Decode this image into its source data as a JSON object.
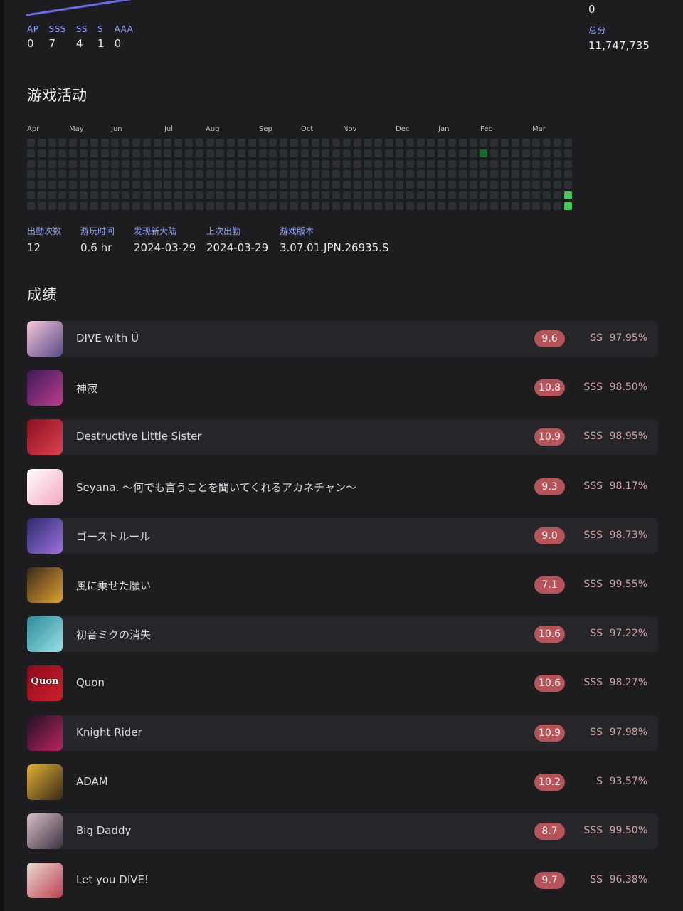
{
  "top_stats": [
    {
      "label": "AP",
      "value": "0"
    },
    {
      "label": "SSS",
      "value": "7"
    },
    {
      "label": "SS",
      "value": "4"
    },
    {
      "label": "S",
      "value": "1"
    },
    {
      "label": "AAA",
      "value": "0"
    }
  ],
  "top_right_value": "0",
  "total": {
    "label": "总分",
    "value": "11,747,735"
  },
  "activity": {
    "title": "游戏活动",
    "months": [
      "Apr",
      "May",
      "Jun",
      "Jul",
      "Aug",
      "Sep",
      "Oct",
      "Nov",
      "Dec",
      "Jan",
      "Feb",
      "Mar"
    ],
    "weeks": 52,
    "active_cells": [
      {
        "week": 43,
        "day": 1,
        "level": 1
      },
      {
        "week": 51,
        "day": 5,
        "level": 3
      },
      {
        "week": 51,
        "day": 6,
        "level": 3
      }
    ],
    "colors": {
      "empty": "#2b2f36",
      "low": "#166a2a",
      "high": "#3fcd51"
    }
  },
  "meta": [
    {
      "label": "出勤次数",
      "value": "12"
    },
    {
      "label": "游玩时间",
      "value": "0.6 hr"
    },
    {
      "label": "发现新大陆",
      "value": "2024-03-29"
    },
    {
      "label": "上次出勤",
      "value": "2024-03-29"
    },
    {
      "label": "游戏版本",
      "value": "3.07.01.JPN.26935.S"
    }
  ],
  "scores": {
    "title": "成绩",
    "rows": [
      {
        "title": "DIVE with Ü",
        "level": "9.6",
        "rank": "SS",
        "accuracy": "97.95%",
        "cover_colors": [
          "#f4c8d8",
          "#5a4a8a"
        ],
        "cover_text": ""
      },
      {
        "title": "神寂",
        "level": "10.8",
        "rank": "SSS",
        "accuracy": "98.50%",
        "cover_colors": [
          "#3a1d5a",
          "#c03a8a"
        ],
        "cover_text": ""
      },
      {
        "title": "Destructive Little Sister",
        "level": "10.9",
        "rank": "SSS",
        "accuracy": "98.95%",
        "cover_colors": [
          "#8a1020",
          "#e04050"
        ],
        "cover_text": ""
      },
      {
        "title": "Seyana. ～何でも言うことを聞いてくれるアカネチャン～",
        "level": "9.3",
        "rank": "SSS",
        "accuracy": "98.17%",
        "cover_colors": [
          "#ffffff",
          "#f4a6c0"
        ],
        "cover_text": ""
      },
      {
        "title": "ゴーストルール",
        "level": "9.0",
        "rank": "SSS",
        "accuracy": "98.73%",
        "cover_colors": [
          "#2a2a6a",
          "#a070e0"
        ],
        "cover_text": ""
      },
      {
        "title": "風に乗せた願い",
        "level": "7.1",
        "rank": "SSS",
        "accuracy": "99.55%",
        "cover_colors": [
          "#3a2a1a",
          "#e0a030"
        ],
        "cover_text": ""
      },
      {
        "title": "初音ミクの消失",
        "level": "10.6",
        "rank": "SS",
        "accuracy": "97.22%",
        "cover_colors": [
          "#2a8a9a",
          "#9ae0e8"
        ],
        "cover_text": ""
      },
      {
        "title": "Quon",
        "level": "10.6",
        "rank": "SSS",
        "accuracy": "98.27%",
        "cover_colors": [
          "#8a0a1a",
          "#d0202a"
        ],
        "cover_text": "Quon"
      },
      {
        "title": "Knight Rider",
        "level": "10.9",
        "rank": "SS",
        "accuracy": "97.98%",
        "cover_colors": [
          "#1a1420",
          "#c02060"
        ],
        "cover_text": ""
      },
      {
        "title": "ADAM",
        "level": "10.2",
        "rank": "S",
        "accuracy": "93.57%",
        "cover_colors": [
          "#e0b030",
          "#3a2a1a"
        ],
        "cover_text": ""
      },
      {
        "title": "Big Daddy",
        "level": "8.7",
        "rank": "SSS",
        "accuracy": "99.50%",
        "cover_colors": [
          "#d8c0c8",
          "#3a3040"
        ],
        "cover_text": ""
      },
      {
        "title": "Let you DIVE!",
        "level": "9.7",
        "rank": "SS",
        "accuracy": "96.38%",
        "cover_colors": [
          "#e8dcd4",
          "#c04050"
        ],
        "cover_text": ""
      }
    ]
  }
}
